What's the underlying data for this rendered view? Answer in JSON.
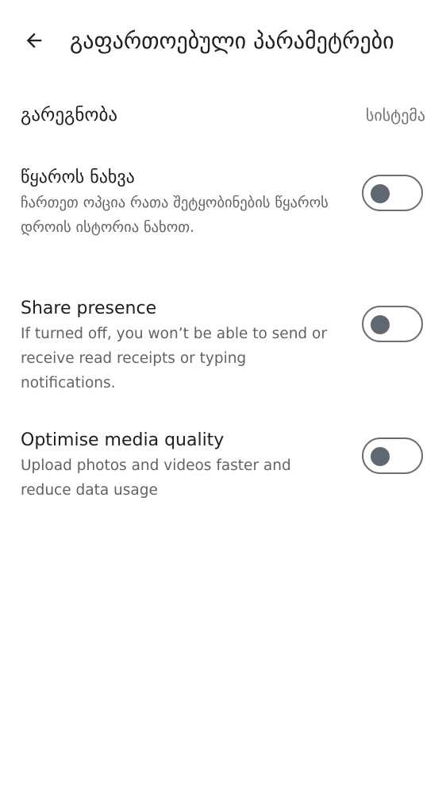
{
  "header": {
    "back_icon": "arrow-back-icon",
    "title": "გაფართოებული პარამეტრები"
  },
  "settings": {
    "appearance": {
      "label": "გარეგნობა",
      "value": "სისტემა"
    },
    "toggles": [
      {
        "title": "წყაროს ნახვა",
        "description": "ჩართეთ ოპცია რათა შეტყობინების წყაროს დროის ისტორია ნახოთ.",
        "checked": false
      },
      {
        "title": "Share presence",
        "description": "If turned off, you won’t be able to send or receive read receipts or typing notifications.",
        "checked": false
      },
      {
        "title": "Optimise media quality",
        "description": "Upload photos and videos faster and reduce data usage",
        "checked": false
      }
    ]
  },
  "colors": {
    "switch_track_border": "#6b6f73",
    "switch_thumb": "#5f6770",
    "secondary_text": "#5f6368"
  }
}
